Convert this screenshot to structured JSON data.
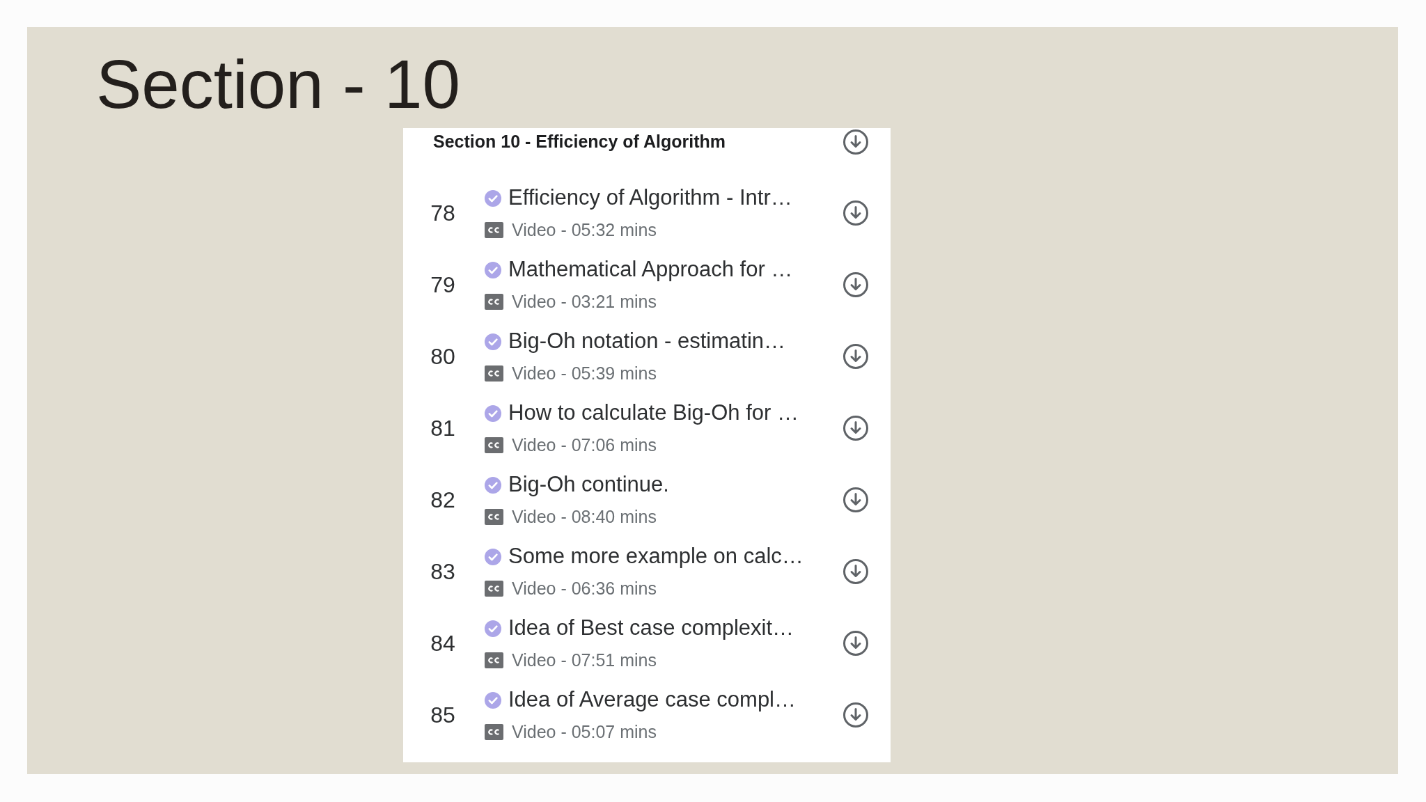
{
  "slide": {
    "title": "Section - 10"
  },
  "section": {
    "title": "Section 10 - Efficiency of Algorithm"
  },
  "lectures": [
    {
      "number": "78",
      "title": "Efficiency of Algorithm - Intr…",
      "completed": true,
      "meta": "Video - 05:32 mins"
    },
    {
      "number": "79",
      "title": "Mathematical Approach for …",
      "completed": true,
      "meta": "Video - 03:21 mins"
    },
    {
      "number": "80",
      "title": "Big-Oh notation - estimatin…",
      "completed": true,
      "meta": "Video - 05:39 mins"
    },
    {
      "number": "81",
      "title": "How to calculate Big-Oh for …",
      "completed": true,
      "meta": "Video - 07:06 mins"
    },
    {
      "number": "82",
      "title": "Big-Oh continue.",
      "completed": true,
      "meta": "Video - 08:40 mins"
    },
    {
      "number": "83",
      "title": "Some more example on calc…",
      "completed": true,
      "meta": "Video - 06:36 mins"
    },
    {
      "number": "84",
      "title": "Idea of Best case complexit…",
      "completed": true,
      "meta": "Video - 07:51 mins"
    },
    {
      "number": "85",
      "title": "Idea of Average case compl…",
      "completed": true,
      "meta": "Video - 05:07 mins"
    }
  ]
}
